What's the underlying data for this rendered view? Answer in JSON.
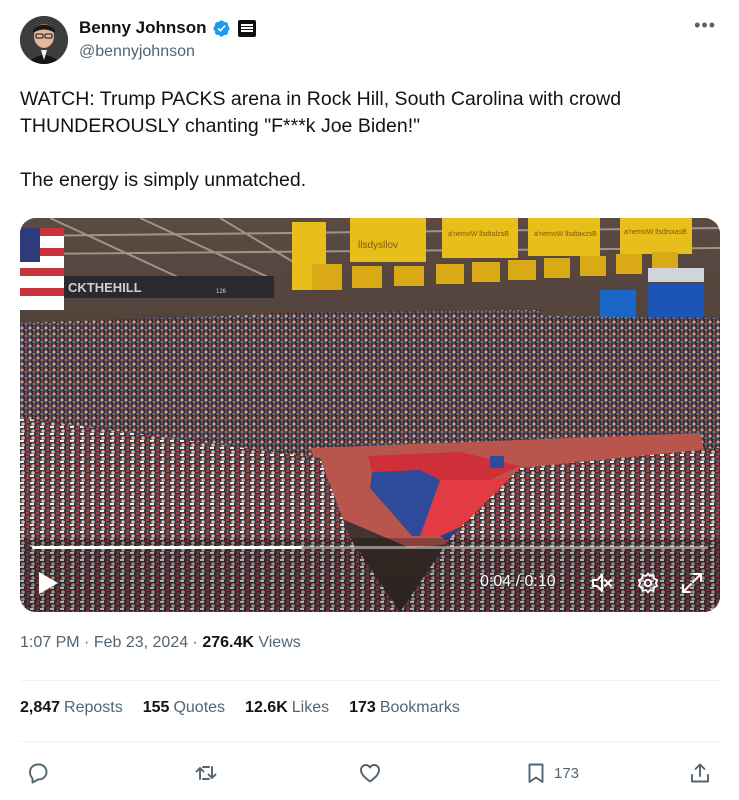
{
  "author": {
    "name": "Benny Johnson",
    "handle": "@bennyjohnson",
    "verified_color": "#1d9bf0"
  },
  "tweet": {
    "line1": "WATCH: Trump PACKS arena in Rock Hill, South Carolina with crowd",
    "line2": "THUNDEROUSLY chanting \"F***k Joe Biden!\"",
    "line3": "The energy is simply unmatched."
  },
  "video": {
    "timecode": "0:04 / 0:10",
    "progress": 0.4,
    "scene_texts": {
      "banner_left": "CKTHEHILL",
      "banner_a": "llsdysllov",
      "banner_b": "a'nemoW llsdtalzsB",
      "banner_c": "a'nemoW llsdtaxzsB",
      "banner_d": "a'nemoW llsdtsxasB",
      "section": "126"
    },
    "icons": [
      "play-icon",
      "volume-icon",
      "settings-gear-icon",
      "fullscreen-icon"
    ]
  },
  "meta": {
    "time": "1:07 PM",
    "sep1": " · ",
    "date": "Feb 23, 2024",
    "sep2": " · ",
    "views_count": "276.4K",
    "views_label": " Views"
  },
  "stats": {
    "reposts_count": "2,847",
    "reposts_label": "Reposts",
    "quotes_count": "155",
    "quotes_label": "Quotes",
    "likes_count": "12.6K",
    "likes_label": "Likes",
    "bookmarks_count": "173",
    "bookmarks_label": "Bookmarks"
  },
  "actions": {
    "reply": "reply-icon",
    "repost": "repost-icon",
    "like": "heart-icon",
    "bookmark": "bookmark-icon",
    "bookmark_count": "173",
    "share": "share-icon"
  },
  "colors": {
    "text": "#0f1419",
    "secondary": "#536471",
    "divider": "#eff3f4",
    "accent": "#1d9bf0"
  }
}
